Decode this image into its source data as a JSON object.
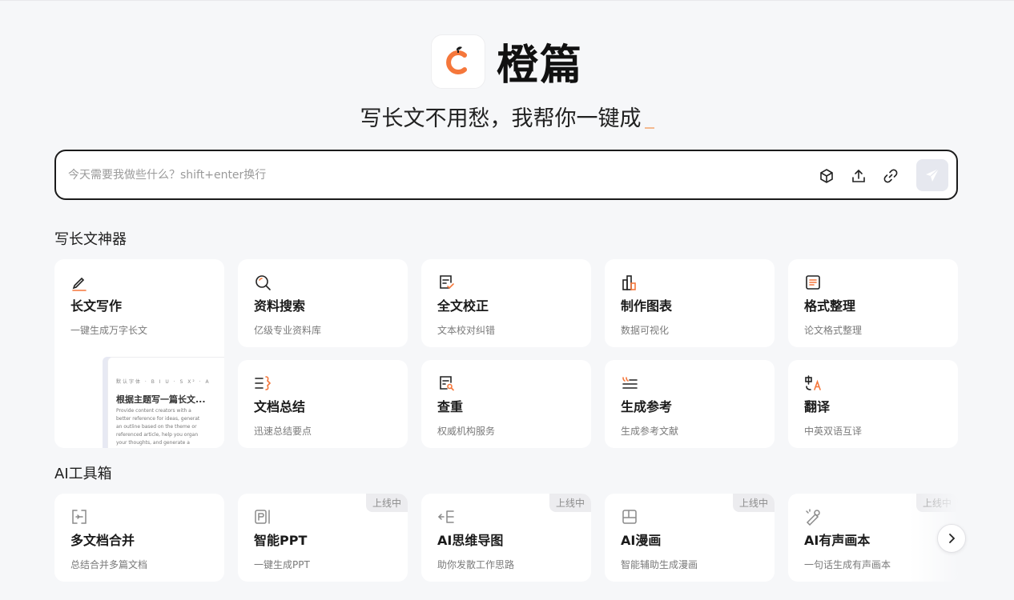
{
  "brand": {
    "name": "橙篇",
    "logo_icon": "orange-c-logo-icon",
    "accent": "#f5773b"
  },
  "slogan": "写长文不用愁，我帮你一键成",
  "search": {
    "placeholder": "今天需要我做些什么？shift+enter换行",
    "icons": [
      "cube-icon",
      "upload-icon",
      "link-icon",
      "send-icon"
    ]
  },
  "section_writing": {
    "title": "写长文神器",
    "cards": [
      {
        "title": "长文写作",
        "desc": "一键生成万字长文",
        "icon": "pen-icon"
      },
      {
        "title": "资料搜索",
        "desc": "亿级专业资料库",
        "icon": "search-icon"
      },
      {
        "title": "全文校正",
        "desc": "文本校对纠错",
        "icon": "doc-check-icon"
      },
      {
        "title": "制作图表",
        "desc": "数据可视化",
        "icon": "bar-chart-icon"
      },
      {
        "title": "格式整理",
        "desc": "论文格式整理",
        "icon": "format-icon"
      },
      {
        "title": "文档总结",
        "desc": "迅速总结要点",
        "icon": "summary-icon"
      },
      {
        "title": "查重",
        "desc": "权威机构服务",
        "icon": "doc-search-icon"
      },
      {
        "title": "生成参考",
        "desc": "生成参考文献",
        "icon": "quote-icon"
      },
      {
        "title": "翻译",
        "desc": "中英双语互译",
        "icon": "translate-icon"
      }
    ],
    "preview": {
      "toolbar": "默认字体 · B I U · S X² · A",
      "title": "根据主题写一篇长文...",
      "lines": [
        "Provide content creators with a",
        "better reference for ideas, generat",
        "an outline based on the theme or",
        "referenced article, help you organ",
        "your thoughts, and generate a"
      ]
    }
  },
  "section_tools": {
    "title": "AI工具箱",
    "badge": "上线中",
    "cards": [
      {
        "title": "多文档合并",
        "desc": "总结合并多篇文档",
        "icon": "merge-icon",
        "badge": false
      },
      {
        "title": "智能PPT",
        "desc": "一键生成PPT",
        "icon": "ppt-icon",
        "badge": true
      },
      {
        "title": "AI思维导图",
        "desc": "助你发散工作思路",
        "icon": "mindmap-icon",
        "badge": true
      },
      {
        "title": "AI漫画",
        "desc": "智能辅助生成漫画",
        "icon": "comic-icon",
        "badge": true
      },
      {
        "title": "AI有声画本",
        "desc": "一句话生成有声画本",
        "icon": "audio-book-icon",
        "badge": true
      }
    ]
  }
}
